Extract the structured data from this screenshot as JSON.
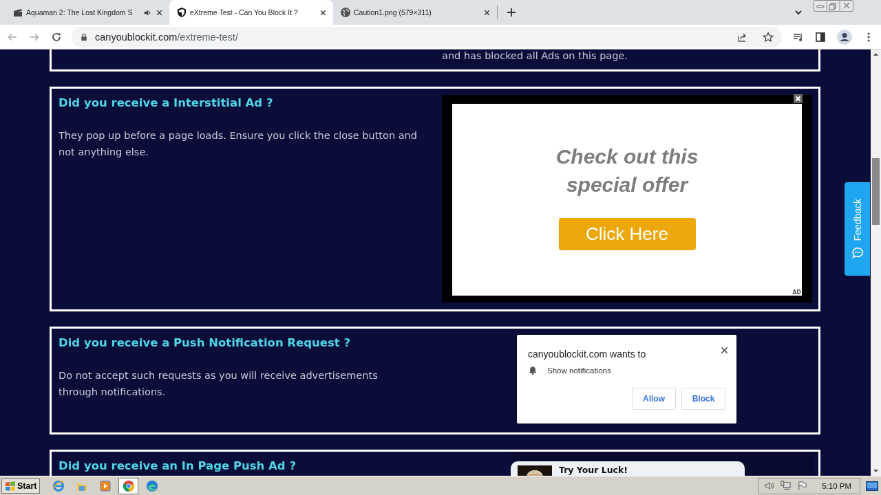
{
  "browser": {
    "tabs": [
      {
        "title": "Aquaman 2: The Lost Kingdom S",
        "kind": "film",
        "audio": true,
        "selected": false
      },
      {
        "title": "eXtreme Test - Can You Block It ?",
        "kind": "shield",
        "audio": false,
        "selected": true
      },
      {
        "title": "Caution1.png (579×311)",
        "kind": "globe",
        "audio": false,
        "selected": false
      }
    ],
    "address": {
      "domain": "canyoublockit.com",
      "path": "/extreme-test/"
    }
  },
  "page": {
    "sections": [
      {
        "kind": "tail",
        "text": "and has blocked all Ads on this page."
      },
      {
        "kind": "interstitial",
        "heading": "Did you receive a Interstitial Ad ?",
        "text": "They pop up before a page loads. Ensure you click the close button and not anything else.",
        "ad": {
          "headline": "Check out this special offer",
          "button": "Click Here",
          "badge": "AD"
        }
      },
      {
        "kind": "push",
        "heading": "Did you receive a Push Notification Request ?",
        "text": "Do not accept such requests as you will receive advertisements through notifications."
      },
      {
        "kind": "inpage",
        "heading": "Did you receive an In Page Push Ad ?",
        "card_title": "Try Your Luck!"
      }
    ],
    "feedback": "Feedback"
  },
  "notification": {
    "title": "canyoublockit.com wants to",
    "permission": "Show notifications",
    "buttons": [
      "Allow",
      "Block"
    ]
  },
  "taskbar": {
    "start": "Start",
    "apps": [
      {
        "kind": "ie",
        "selected": false
      },
      {
        "kind": "folder",
        "selected": false
      },
      {
        "kind": "player",
        "selected": false
      },
      {
        "kind": "chrome",
        "selected": true
      },
      {
        "kind": "edge",
        "selected": false
      }
    ],
    "clock": "5:10 PM"
  }
}
